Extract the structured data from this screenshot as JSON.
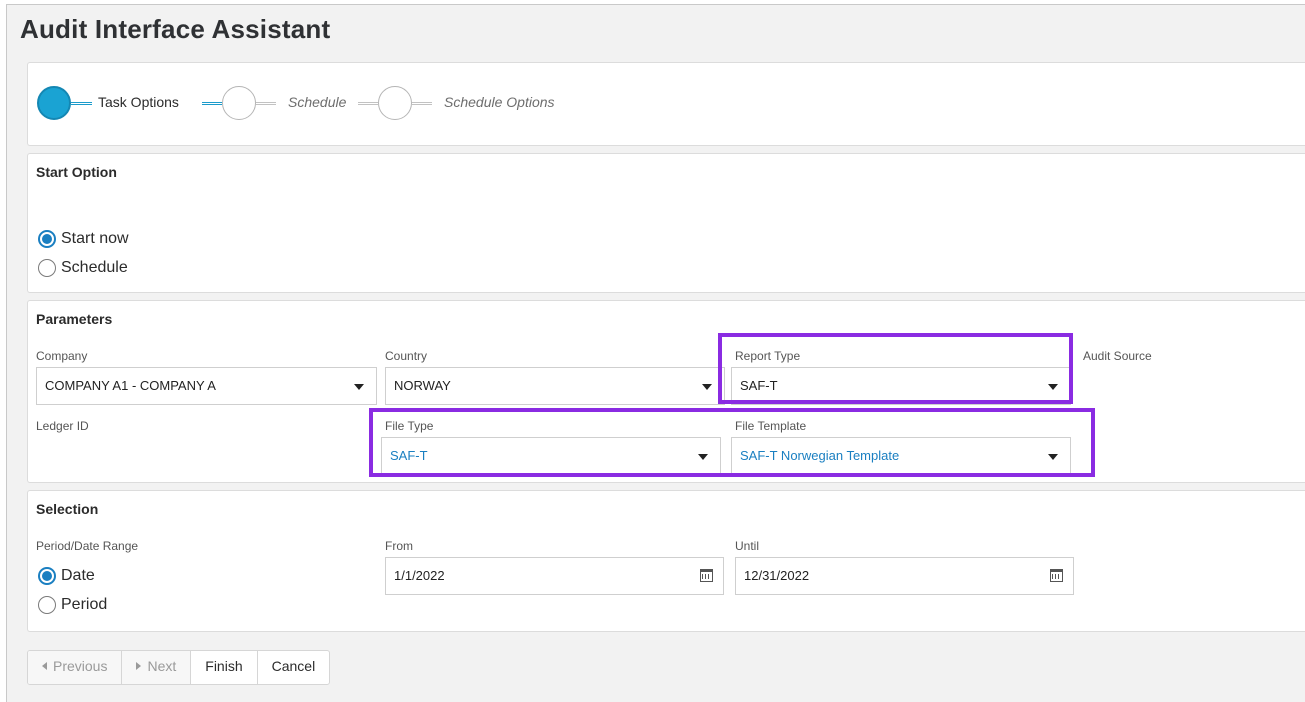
{
  "page": {
    "title": "Audit Interface Assistant"
  },
  "stepper": {
    "steps": [
      {
        "label": "Task Options",
        "state": "active"
      },
      {
        "label": "Schedule",
        "state": "idle"
      },
      {
        "label": "Schedule Options",
        "state": "idle"
      }
    ]
  },
  "start_option": {
    "title": "Start Option",
    "options": [
      {
        "label": "Start now",
        "checked": true
      },
      {
        "label": "Schedule",
        "checked": false
      }
    ]
  },
  "parameters": {
    "title": "Parameters",
    "company": {
      "label": "Company",
      "value": "COMPANY A1 - COMPANY A"
    },
    "country": {
      "label": "Country",
      "value": "NORWAY"
    },
    "report_type": {
      "label": "Report Type",
      "value": "SAF-T"
    },
    "audit_source": {
      "label": "Audit Source"
    },
    "ledger_id": {
      "label": "Ledger ID"
    },
    "file_type": {
      "label": "File Type",
      "value": "SAF-T"
    },
    "file_template": {
      "label": "File Template",
      "value": "SAF-T Norwegian Template"
    }
  },
  "selection": {
    "title": "Selection",
    "period_label": "Period/Date Range",
    "options": [
      {
        "label": "Date",
        "checked": true
      },
      {
        "label": "Period",
        "checked": false
      }
    ],
    "from": {
      "label": "From",
      "value": "1/1/2022"
    },
    "until": {
      "label": "Until",
      "value": "12/31/2022"
    }
  },
  "buttons": {
    "previous": "Previous",
    "next": "Next",
    "finish": "Finish",
    "cancel": "Cancel"
  },
  "colors": {
    "accent": "#1aa3d3",
    "highlight": "#8a2be2",
    "link": "#1a7fc1"
  }
}
